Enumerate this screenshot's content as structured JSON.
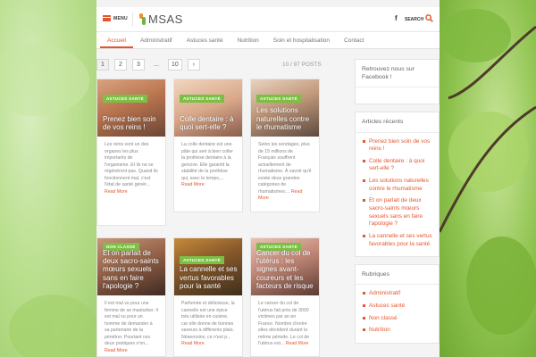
{
  "header": {
    "menu_label": "MENU",
    "logo_text": "MSAS",
    "facebook_icon": "facebook-icon",
    "search_label": "SEARCH",
    "search_icon": "search-icon"
  },
  "nav": {
    "items": [
      "Accueil",
      "Administratif",
      "Astuces santé",
      "Nutrition",
      "Soin et hospitalisation",
      "Contact"
    ],
    "active": "Accueil"
  },
  "pagination": {
    "pages": [
      "1",
      "2",
      "3",
      "...",
      "10"
    ],
    "next": "›",
    "current": "1",
    "count_text": "10 / 97 POSTS"
  },
  "posts": [
    {
      "category": "ASTUCES SANTÉ",
      "title": "Prenez bien soin de vos reins !",
      "excerpt": "Les reins sont un des organes les plus importants de l'organisme. Et ils ne se régénèrent pas. Quand ils fonctionnent mal, c'est l'état de santé génér...",
      "more": "Read More"
    },
    {
      "category": "ASTUCES SANTÉ",
      "title": "Colle dentaire : à quoi sert-elle ?",
      "excerpt": "La colle dentaire est une pâte qui sert à bien coller la prothèse dentaire à la gencive. Elle garantit la stabilité de la prothèse qui, avec le temps,...",
      "more": "Read More"
    },
    {
      "category": "ASTUCES SANTÉ",
      "title": "Les solutions naturelles contre le rhumatisme",
      "excerpt": "Selon les sondages, plus de 15 millions de Français souffrent actuellement de rhumatisme. À savoir qu'il existe deux grandes catégories de rhumatismes:...",
      "more": "Read More"
    },
    {
      "category": "NON CLASSÉ",
      "title": "Et on parlait de deux sacro-saints mœurs sexuels sans en faire l'apologie ?",
      "excerpt": "Il est mal vu pour une femme de se masturber. Il est mal vu pour un homme de demander à sa partenaire de la pénétrer. Pourtant ces deux pratiques n'on...",
      "more": "Read More"
    },
    {
      "category": "ASTUCES SANTÉ",
      "title": "La cannelle et ses vertus favorables pour la santé",
      "excerpt": "Parfumée et délicieuse, la cannelle est une épice très utilisée en cuisine, car elle donne de bonnes saveurs à différents plats. Néanmoins, ce n'est p...",
      "more": "Read More"
    },
    {
      "category": "ASTUCES SANTÉ",
      "title": "Cancer du col de l'utérus : les signes avant-coureurs et les facteurs de risque",
      "excerpt": "Le cancer du col de l'utérus fait près de 3000 victimes par an en France. Nombre d'entre elles décèdent durant la même période. Le col de l'utérus est...",
      "more": "Read More"
    }
  ],
  "sidebar": {
    "facebook_title": "Retrouvez nous sur Facebook !",
    "recent_title": "Articles récents",
    "recent": [
      "Prenez bien soin de vos reins !",
      "Colle dentaire : à quoi sert-elle ?",
      "Les solutions naturelles contre le rhumatisme",
      "Et on parlait de deux sacro-saints mœurs sexuels sans en faire l'apologie ?",
      "La cannelle et ses vertus favorables pour la santé"
    ],
    "rubriques_title": "Rubriques",
    "rubriques": [
      "Administratif",
      "Astuces santé",
      "Non classé",
      "Nutrition"
    ]
  },
  "colors": {
    "accent": "#e4572e",
    "category_badge": "#7cbf45",
    "logo_orange": "#f28c28",
    "logo_green": "#6cb33f"
  }
}
